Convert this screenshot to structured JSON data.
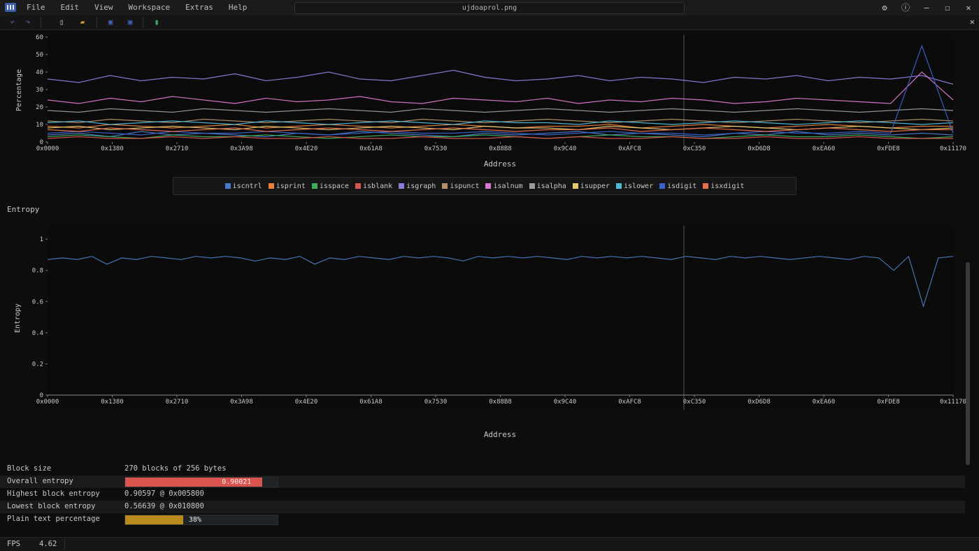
{
  "titlebar": {
    "menu": [
      "File",
      "Edit",
      "View",
      "Workspace",
      "Extras",
      "Help"
    ],
    "filename": "ujdoaprol.png"
  },
  "icons": {
    "logo": "imhex-logo-icon",
    "toolbar": [
      "undo-icon",
      "redo-icon",
      "new-file-icon",
      "open-folder-icon",
      "save-icon",
      "save-as-icon",
      "bookmark-icon"
    ],
    "window": [
      "settings-icon",
      "info-icon",
      "minimize-icon",
      "maximize-icon",
      "close-icon"
    ]
  },
  "colors": {
    "accent_red": "#d9534f",
    "accent_gold": "#b88a1e",
    "entropy_line": "#4a78b8"
  },
  "x_ticks": [
    "0x0000",
    "0x1380",
    "0x2710",
    "0x3A98",
    "0x4E20",
    "0x61A8",
    "0x7530",
    "0x88B8",
    "0x9C40",
    "0xAFC8",
    "0xC350",
    "0xD6D8",
    "0xEA60",
    "0xFDE8",
    "0x11170"
  ],
  "chart_data": [
    {
      "type": "line",
      "ylabel": "Percentage",
      "xlabel": "Address",
      "ylim": [
        0,
        60
      ],
      "yticks": [
        "60",
        "50",
        "40",
        "30",
        "20",
        "10",
        "0"
      ],
      "legend_placement": "bottom",
      "series": [
        {
          "name": "iscntrl",
          "color": "#4a78c8",
          "values": [
            4,
            5,
            3,
            6,
            4,
            5,
            4,
            3,
            5,
            4,
            6,
            5,
            4,
            3,
            5,
            4,
            5,
            6,
            4,
            5,
            4,
            3,
            5,
            4,
            6,
            4,
            5,
            4,
            5,
            4
          ]
        },
        {
          "name": "isprint",
          "color": "#e8803a",
          "values": [
            9,
            8,
            10,
            9,
            8,
            9,
            10,
            8,
            9,
            10,
            9,
            8,
            9,
            10,
            9,
            8,
            9,
            9,
            10,
            8,
            9,
            10,
            9,
            8,
            9,
            10,
            9,
            8,
            9,
            9
          ]
        },
        {
          "name": "isspace",
          "color": "#3fae5a",
          "values": [
            3,
            4,
            3,
            2,
            4,
            3,
            3,
            4,
            3,
            2,
            3,
            4,
            3,
            3,
            4,
            3,
            2,
            3,
            4,
            3,
            3,
            2,
            3,
            4,
            3,
            3,
            4,
            3,
            2,
            3
          ]
        },
        {
          "name": "isblank",
          "color": "#d9534f",
          "values": [
            2,
            3,
            2,
            2,
            3,
            2,
            3,
            2,
            2,
            3,
            2,
            2,
            3,
            2,
            2,
            3,
            2,
            3,
            2,
            2,
            3,
            2,
            2,
            3,
            2,
            2,
            3,
            2,
            2,
            2
          ]
        },
        {
          "name": "isgraph",
          "color": "#8f7bd6",
          "values": [
            36,
            34,
            38,
            35,
            37,
            36,
            39,
            35,
            37,
            40,
            36,
            35,
            38,
            41,
            37,
            35,
            36,
            38,
            35,
            37,
            36,
            34,
            37,
            36,
            38,
            35,
            37,
            36,
            38,
            33
          ]
        },
        {
          "name": "ispunct",
          "color": "#b0916c",
          "values": [
            12,
            11,
            13,
            12,
            11,
            13,
            12,
            11,
            12,
            13,
            12,
            11,
            13,
            12,
            11,
            12,
            13,
            12,
            11,
            12,
            13,
            12,
            11,
            12,
            13,
            12,
            11,
            12,
            13,
            12
          ]
        },
        {
          "name": "isalnum",
          "color": "#d678c8",
          "values": [
            24,
            22,
            25,
            23,
            26,
            24,
            22,
            25,
            23,
            24,
            26,
            23,
            22,
            25,
            24,
            23,
            25,
            22,
            24,
            23,
            25,
            24,
            22,
            23,
            25,
            24,
            23,
            22,
            40,
            24
          ]
        },
        {
          "name": "isalpha",
          "color": "#9a9a9a",
          "values": [
            18,
            17,
            19,
            18,
            17,
            19,
            18,
            17,
            18,
            19,
            18,
            17,
            19,
            18,
            17,
            18,
            19,
            18,
            17,
            18,
            19,
            18,
            17,
            18,
            19,
            18,
            17,
            18,
            19,
            18
          ]
        },
        {
          "name": "isupper",
          "color": "#e3c870",
          "values": [
            8,
            9,
            7,
            8,
            9,
            8,
            7,
            9,
            8,
            7,
            8,
            9,
            8,
            7,
            9,
            8,
            8,
            7,
            9,
            8,
            7,
            8,
            9,
            8,
            7,
            8,
            9,
            8,
            7,
            8
          ]
        },
        {
          "name": "islower",
          "color": "#4fb8d8",
          "values": [
            11,
            12,
            10,
            11,
            12,
            11,
            10,
            12,
            11,
            10,
            11,
            12,
            11,
            10,
            12,
            11,
            11,
            10,
            12,
            11,
            10,
            11,
            12,
            11,
            10,
            11,
            12,
            11,
            10,
            11
          ]
        },
        {
          "name": "isdigit",
          "color": "#3a62c8",
          "values": [
            5,
            6,
            5,
            4,
            6,
            5,
            5,
            6,
            5,
            4,
            5,
            6,
            5,
            5,
            6,
            5,
            4,
            5,
            6,
            5,
            5,
            4,
            5,
            6,
            5,
            5,
            6,
            5,
            55,
            5
          ]
        },
        {
          "name": "isxdigit",
          "color": "#e87050",
          "values": [
            7,
            6,
            8,
            7,
            6,
            7,
            8,
            6,
            7,
            8,
            7,
            6,
            7,
            8,
            7,
            6,
            7,
            7,
            8,
            6,
            7,
            8,
            7,
            6,
            7,
            8,
            7,
            6,
            7,
            7
          ]
        }
      ]
    },
    {
      "type": "line",
      "title": "Entropy",
      "ylabel": "Entropy",
      "xlabel": "Address",
      "ylim": [
        0,
        1.05
      ],
      "yticks": [
        "1",
        "0.8",
        "0.6",
        "0.4",
        "0.2",
        "0"
      ],
      "series": [
        {
          "name": "entropy",
          "color": "#4a78b8",
          "values": [
            0.87,
            0.88,
            0.87,
            0.89,
            0.84,
            0.88,
            0.87,
            0.89,
            0.88,
            0.87,
            0.89,
            0.88,
            0.89,
            0.88,
            0.86,
            0.88,
            0.87,
            0.89,
            0.84,
            0.88,
            0.87,
            0.89,
            0.88,
            0.87,
            0.89,
            0.88,
            0.89,
            0.88,
            0.86,
            0.89,
            0.88,
            0.89,
            0.88,
            0.89,
            0.88,
            0.87,
            0.89,
            0.88,
            0.89,
            0.88,
            0.89,
            0.88,
            0.87,
            0.89,
            0.88,
            0.87,
            0.89,
            0.88,
            0.89,
            0.88,
            0.87,
            0.88,
            0.89,
            0.88,
            0.87,
            0.89,
            0.88,
            0.8,
            0.89,
            0.57,
            0.88,
            0.89
          ]
        }
      ]
    }
  ],
  "stats": {
    "block_size_label": "Block size",
    "block_size_value": "270 blocks of 256 bytes",
    "overall_label": "Overall entropy",
    "overall_value": "0.90021",
    "overall_fraction": 0.9,
    "highest_label": "Highest block entropy",
    "highest_value": "0.90597 @ 0x005800",
    "lowest_label": "Lowest block entropy",
    "lowest_value": "0.56639 @ 0x010800",
    "plain_label": "Plain text percentage",
    "plain_value": "38%",
    "plain_fraction": 0.38
  },
  "status": {
    "fps_label": "FPS",
    "fps_value": "4.62"
  }
}
